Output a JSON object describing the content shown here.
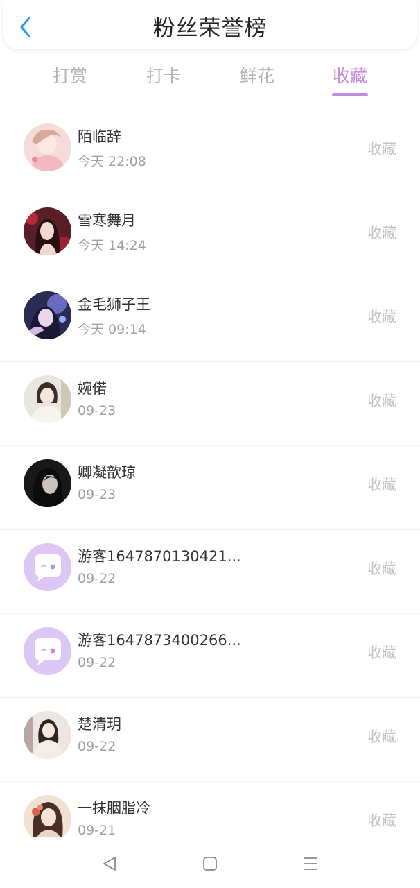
{
  "header": {
    "title": "粉丝荣誉榜"
  },
  "tabs": [
    {
      "label": "打赏"
    },
    {
      "label": "打卡"
    },
    {
      "label": "鲜花"
    },
    {
      "label": "收藏"
    }
  ],
  "active_tab": "收藏",
  "colors": {
    "accent": "#c58be0",
    "back_arrow": "#2a9ef0",
    "muted": "#a0a0a0"
  },
  "fans": [
    {
      "name": "陌临辞",
      "time": "今天 22:08",
      "action": "收藏",
      "avatar": "photo-avatar-icon"
    },
    {
      "name": "雪寒舞月",
      "time": "今天 14:24",
      "action": "收藏",
      "avatar": "photo-avatar-icon"
    },
    {
      "name": "金毛狮子王",
      "time": "今天 09:14",
      "action": "收藏",
      "avatar": "photo-avatar-icon"
    },
    {
      "name": "婉偌",
      "time": "09-23",
      "action": "收藏",
      "avatar": "photo-avatar-icon"
    },
    {
      "name": "卿凝歆琼",
      "time": "09-23",
      "action": "收藏",
      "avatar": "photo-avatar-icon"
    },
    {
      "name": "游客1647870130421...",
      "time": "09-22",
      "action": "收藏",
      "avatar": "chat-bubble-avatar-icon"
    },
    {
      "name": "游客1647873400266...",
      "time": "09-22",
      "action": "收藏",
      "avatar": "chat-bubble-avatar-icon"
    },
    {
      "name": "楚清玥",
      "time": "09-22",
      "action": "收藏",
      "avatar": "photo-avatar-icon"
    },
    {
      "name": "一抹胭脂冷",
      "time": "09-21",
      "action": "收藏",
      "avatar": "photo-avatar-icon"
    }
  ],
  "navbar": {
    "back": "triangle-back-icon",
    "home": "square-home-icon",
    "menu": "menu-lines-icon"
  }
}
